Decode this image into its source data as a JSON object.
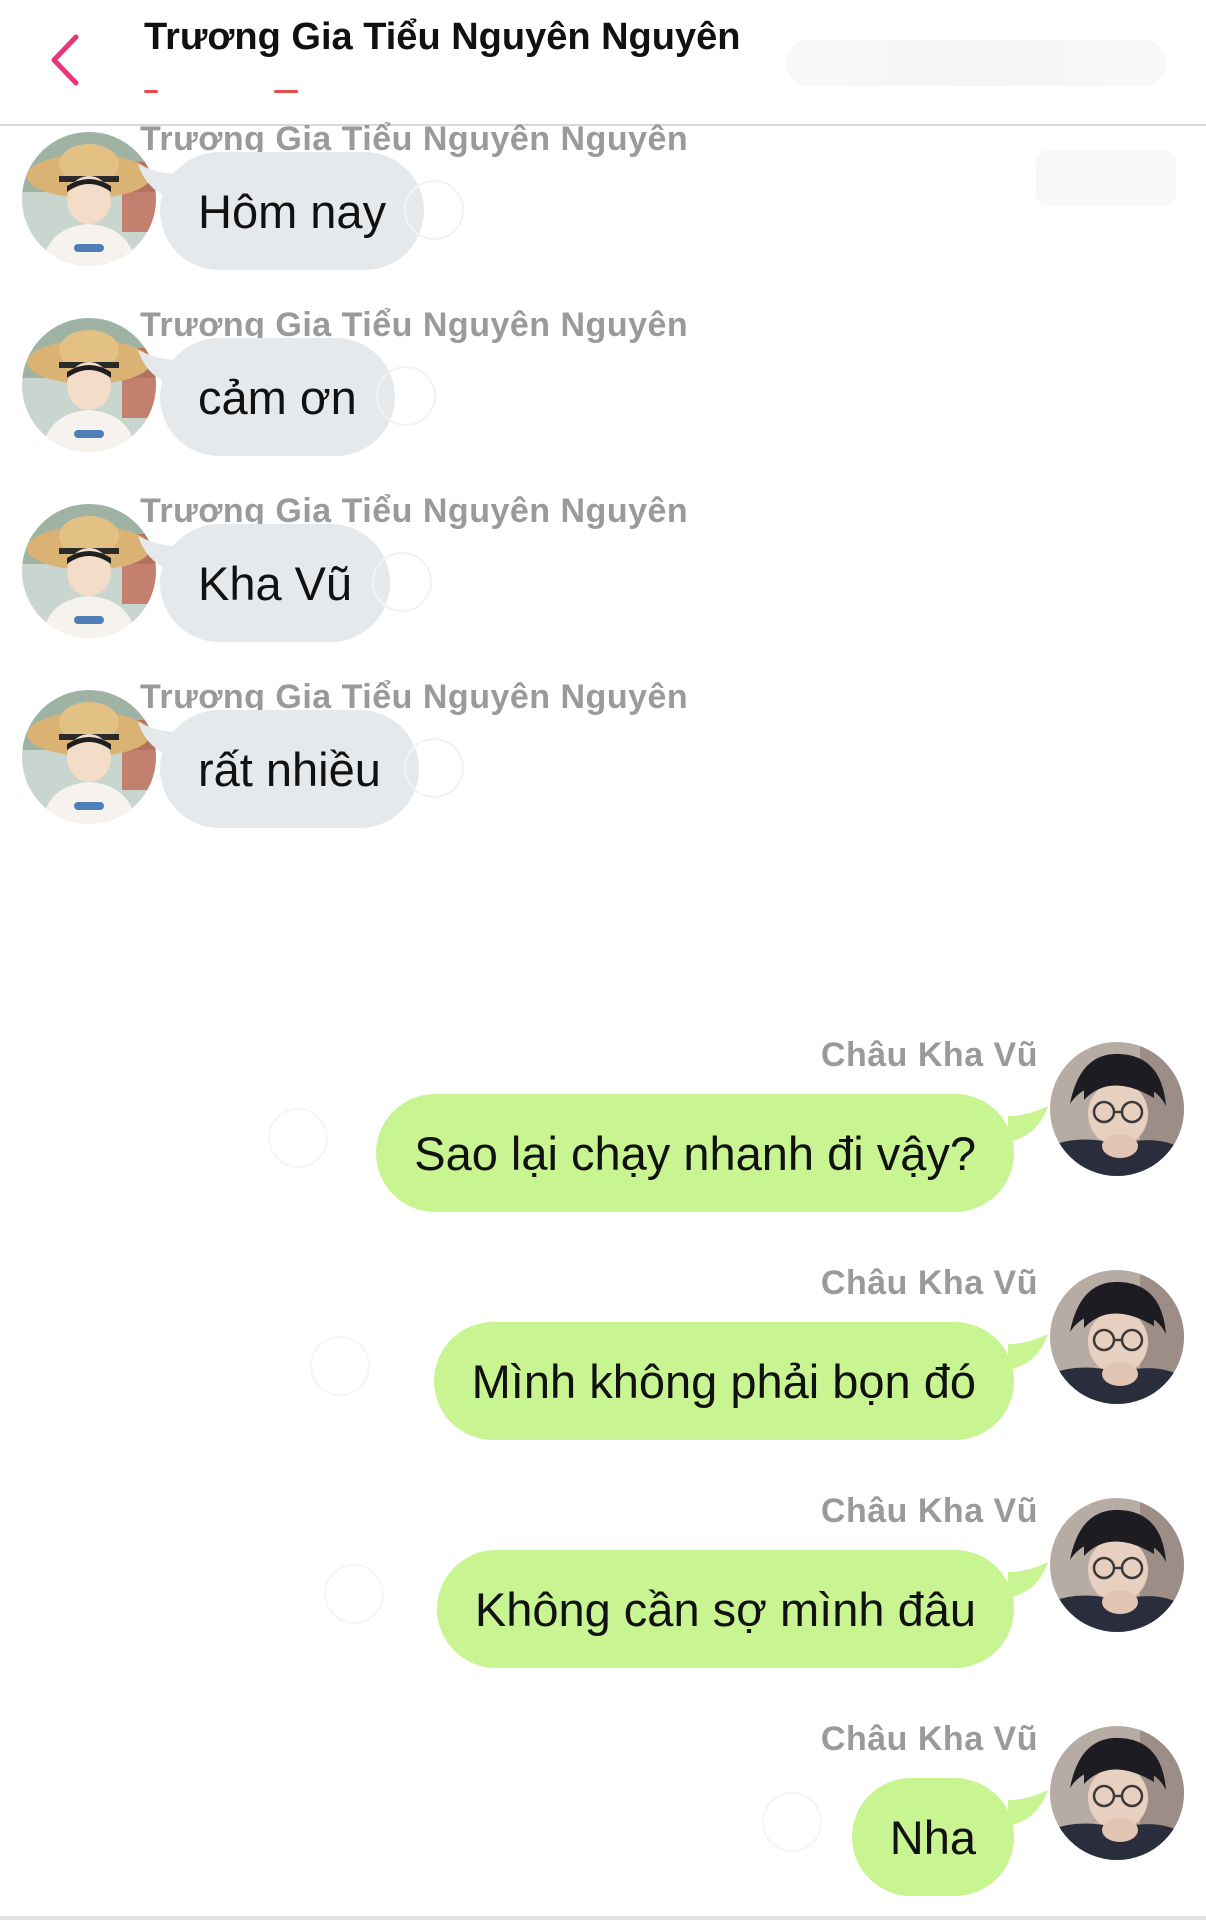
{
  "header": {
    "title": "Trương Gia Tiểu Nguyên Nguyên"
  },
  "colors": {
    "accent": "#e8357a",
    "incoming_bubble": "#e6e9ec",
    "outgoing_bubble": "#c9f492",
    "sender_name": "#9a9a9a"
  },
  "messages": [
    {
      "direction": "in",
      "sender": "Trương Gia Tiểu Nguyên Nguyên",
      "text": "Hôm nay"
    },
    {
      "direction": "in",
      "sender": "Trương Gia Tiểu Nguyên Nguyên",
      "text": "cảm ơn"
    },
    {
      "direction": "in",
      "sender": "Trương Gia Tiểu Nguyên Nguyên",
      "text": "Kha Vũ"
    },
    {
      "direction": "in",
      "sender": "Trương Gia Tiểu Nguyên Nguyên",
      "text": "rất nhiều"
    },
    {
      "direction": "out",
      "sender": "Châu Kha Vũ",
      "text": "Sao lại chạy nhanh đi vậy?"
    },
    {
      "direction": "out",
      "sender": "Châu Kha Vũ",
      "text": "Mình không phải bọn đó"
    },
    {
      "direction": "out",
      "sender": "Châu Kha Vũ",
      "text": "Không cần sợ mình đâu"
    },
    {
      "direction": "out",
      "sender": "Châu Kha Vũ",
      "text": "Nha"
    }
  ]
}
